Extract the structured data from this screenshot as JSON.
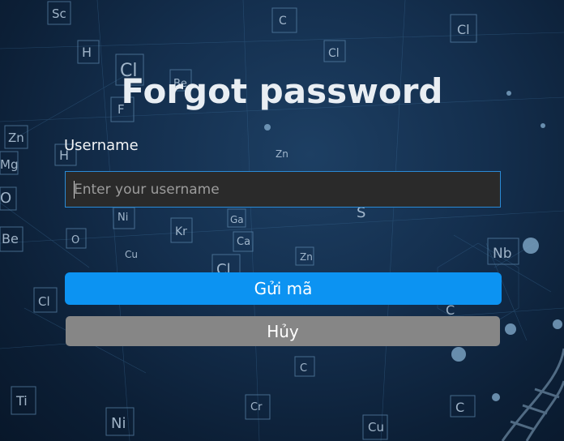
{
  "page": {
    "title": "Forgot password"
  },
  "form": {
    "username_label": "Username",
    "username_value": "",
    "username_placeholder": "Enter your username",
    "send_button_label": "Gửi mã",
    "cancel_button_label": "Hủy"
  },
  "colors": {
    "background": "#142f4e",
    "input_background": "#2a2a2a",
    "input_border": "#2a8ad6",
    "send_button": "#0c93f2",
    "cancel_button": "#868686"
  },
  "background_symbols": [
    "Sc",
    "H",
    "Cl",
    "Be",
    "F",
    "C",
    "Cl",
    "Zn",
    "Mg",
    "O",
    "Be",
    "H",
    "Ni",
    "Kr",
    "Ga",
    "Ca",
    "O",
    "Cu",
    "Cl",
    "S",
    "Cl",
    "Nb",
    "Cr",
    "Ni",
    "Cu",
    "Ti",
    "C",
    "Zn"
  ]
}
